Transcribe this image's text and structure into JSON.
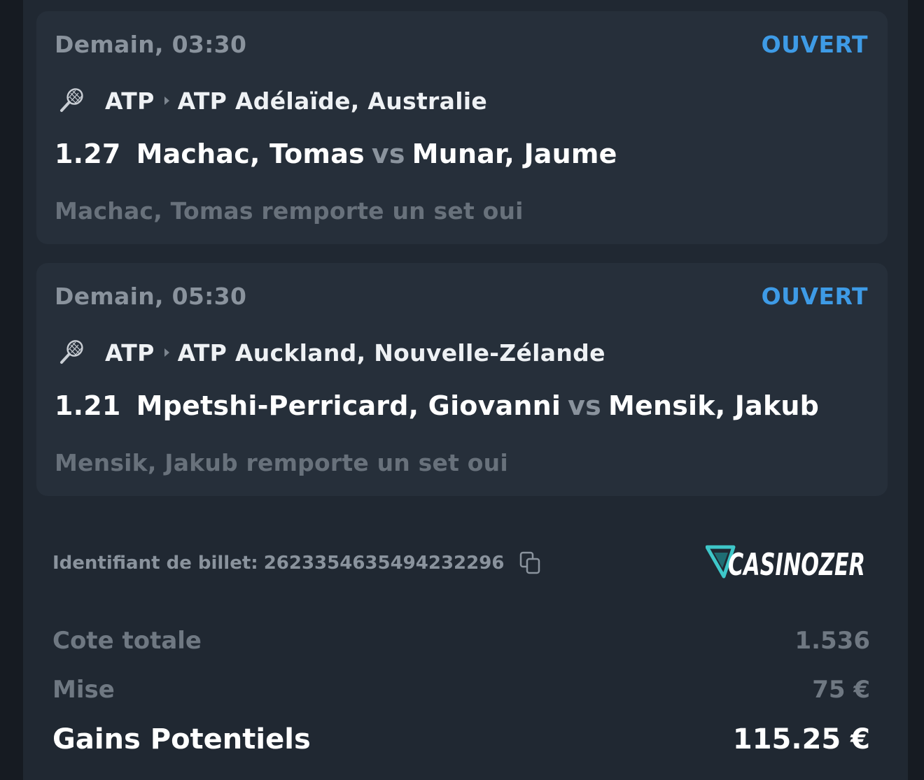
{
  "bets": [
    {
      "date": "Demain, 03:30",
      "status": "OUVERT",
      "sport_icon": "tennis-racket-icon",
      "league": "ATP",
      "tournament": "ATP Adélaïde, Australie",
      "odds": "1.27",
      "player1": "Machac, Tomas",
      "vs": "vs",
      "player2": "Munar, Jaume",
      "selection": "Machac, Tomas remporte un set oui"
    },
    {
      "date": "Demain, 05:30",
      "status": "OUVERT",
      "sport_icon": "tennis-racket-icon",
      "league": "ATP",
      "tournament": "ATP Auckland, Nouvelle-Zélande",
      "odds": "1.21",
      "player1": "Mpetshi-Perricard, Giovanni",
      "vs": "vs",
      "player2": "Mensik, Jakub",
      "selection": "Mensik, Jakub remporte un set oui"
    }
  ],
  "ticket": {
    "label": "Identifiant de billet:",
    "id": "2623354635494232296",
    "copy_icon": "copy-icon"
  },
  "brand": {
    "name": "CASINOZER",
    "accent": "#3ec7c9"
  },
  "summary": {
    "total_odds_label": "Cote totale",
    "total_odds_value": "1.536",
    "stake_label": "Mise",
    "stake_value": "75 €",
    "potential_label": "Gains Potentiels",
    "potential_value": "115.25 €"
  },
  "colors": {
    "background": "#161b22",
    "panel": "#202832",
    "card": "#262f3a",
    "status_open": "#3e9be6",
    "muted_text": "#8a939d",
    "primary_text": "#ffffff"
  }
}
